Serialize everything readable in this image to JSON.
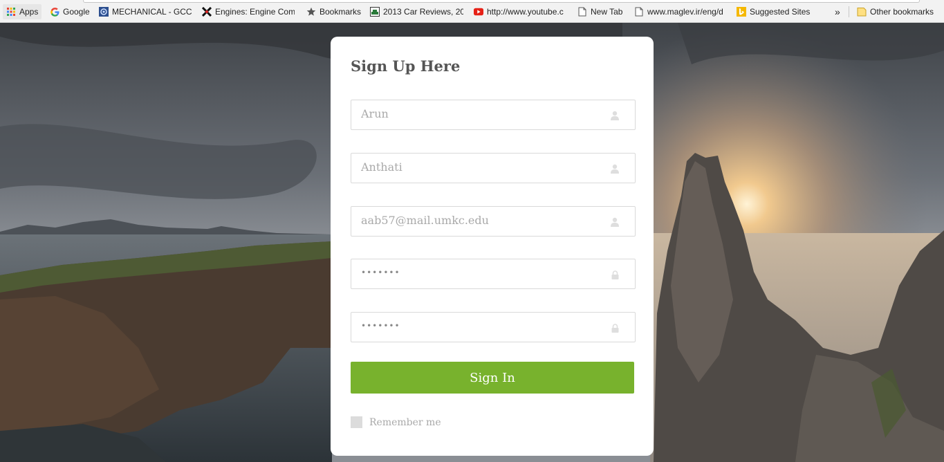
{
  "bookmarks_bar": {
    "items": [
      {
        "label": "Apps",
        "icon": "apps-grid-icon"
      },
      {
        "label": "Google",
        "icon": "google-icon"
      },
      {
        "label": "MECHANICAL - GCC E",
        "icon": "site-favicon"
      },
      {
        "label": "Engines: Engine Comp",
        "icon": "engines-favicon"
      },
      {
        "label": "Bookmarks",
        "icon": "star-icon"
      },
      {
        "label": "2013 Car Reviews, 201",
        "icon": "car-site-favicon"
      },
      {
        "label": "http://www.youtube.c",
        "icon": "youtube-icon"
      },
      {
        "label": "New Tab",
        "icon": "page-icon"
      },
      {
        "label": "www.maglev.ir/eng/d",
        "icon": "page-icon"
      },
      {
        "label": "Suggested Sites",
        "icon": "bing-icon"
      }
    ],
    "overflow": "»",
    "other_bookmarks": {
      "label": "Other bookmarks",
      "icon": "folder-icon"
    }
  },
  "signup": {
    "title": "Sign Up Here",
    "fields": [
      {
        "value": "Arun",
        "icon": "user-icon"
      },
      {
        "value": "Anthati",
        "icon": "user-icon"
      },
      {
        "value": "aab57@mail.umkc.edu",
        "icon": "user-icon"
      },
      {
        "value": "•••••••",
        "icon": "lock-icon"
      },
      {
        "value": "•••••••",
        "icon": "lock-icon"
      }
    ],
    "submit_label": "Sign In",
    "remember_label": "Remember me"
  },
  "colors": {
    "accent_green": "#78b22d",
    "card_bg": "#ffffff",
    "field_border": "#d9d9d9",
    "muted_text": "#a9a9a9"
  }
}
